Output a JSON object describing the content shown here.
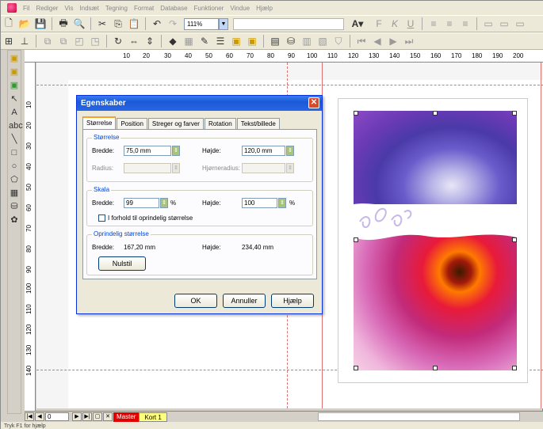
{
  "menubar": {
    "items": [
      "Fil",
      "Rediger",
      "Vis",
      "Indsæt",
      "Tegning",
      "Format",
      "Database",
      "Funktioner",
      "Vindue",
      "Hjælp"
    ]
  },
  "toolbar": {
    "zoom": "111%"
  },
  "ruler": {
    "h_ticks": [
      "10",
      "20",
      "30",
      "40",
      "50",
      "60",
      "70",
      "80",
      "90",
      "100",
      "110",
      "120",
      "130",
      "140",
      "150",
      "160",
      "170",
      "180",
      "190",
      "200"
    ],
    "v_ticks": [
      "10",
      "20",
      "30",
      "40",
      "50",
      "60",
      "70",
      "80",
      "90",
      "100",
      "110",
      "120",
      "130",
      "140"
    ]
  },
  "dialog": {
    "title": "Egenskaber",
    "tabs": [
      "Størrelse",
      "Position",
      "Streger og farver",
      "Rotation",
      "Tekst/billede"
    ],
    "groups": {
      "size": {
        "title": "Størrelse",
        "width_label": "Bredde:",
        "width_value": "75,0 mm",
        "height_label": "Højde:",
        "height_value": "120,0 mm",
        "radius_label": "Radius:",
        "radius_value": "",
        "corner_radius_label": "Hjørneradius:",
        "corner_radius_value": ""
      },
      "scale": {
        "title": "Skala",
        "width_label": "Bredde:",
        "width_value": "99",
        "width_unit": "%",
        "height_label": "Højde:",
        "height_value": "100",
        "height_unit": "%",
        "keep_ratio_label": "I forhold til oprindelig størrelse"
      },
      "original": {
        "title": "Oprindelig størrelse",
        "width_label": "Bredde:",
        "width_value": "167,20 mm",
        "height_label": "Højde:",
        "height_value": "234,40 mm",
        "reset_label": "Nulstil"
      }
    },
    "buttons": {
      "ok": "OK",
      "cancel": "Annuller",
      "help": "Hjælp"
    }
  },
  "tabbar": {
    "page_number": "0",
    "tab_master": "Master",
    "tab_kort": "Kort 1"
  },
  "statusbar": {
    "text": "Tryk F1 for hjælp"
  },
  "colors": {
    "dialog_title": "#1a5ad8",
    "master_tab": "#e00000",
    "kort_tab": "#ffff80",
    "guide": "#e07070"
  }
}
